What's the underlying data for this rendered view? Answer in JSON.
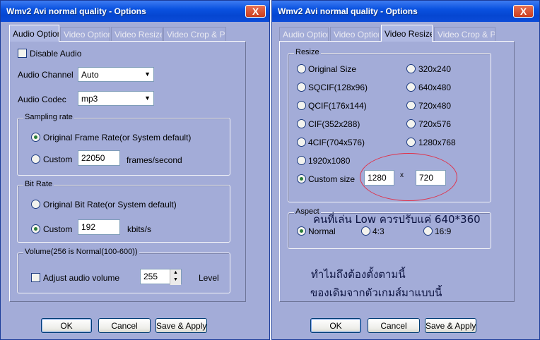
{
  "left_window": {
    "title": "Wmv2 Avi normal quality - Options",
    "close_label": "X",
    "tabs": [
      "Audio Option",
      "Video Option",
      "Video Resize",
      "Video Crop & Pac"
    ],
    "disable_audio_label": "Disable Audio",
    "audio_channel_label": "Audio Channel",
    "audio_channel_value": "Auto",
    "audio_codec_label": "Audio Codec",
    "audio_codec_value": "mp3",
    "sampling": {
      "legend": "Sampling rate",
      "original_label": "Original Frame Rate(or System default)",
      "custom_label": "Custom",
      "custom_value": "22050",
      "unit": "frames/second"
    },
    "bitrate": {
      "legend": "Bit Rate",
      "original_label": "Original Bit Rate(or System default)",
      "custom_label": "Custom",
      "custom_value": "192",
      "unit": "kbits/s"
    },
    "volume": {
      "legend": "Volume(256 is Normal(100-600))",
      "adjust_label": "Adjust audio volume",
      "value": "255",
      "level_label": "Level"
    },
    "buttons": {
      "ok": "OK",
      "cancel": "Cancel",
      "save": "Save & Apply"
    }
  },
  "right_window": {
    "title": "Wmv2 Avi normal quality - Options",
    "close_label": "X",
    "tabs": [
      "Audio Option",
      "Video Option",
      "Video Resize",
      "Video Crop & Pac"
    ],
    "resize": {
      "legend": "Resize",
      "left_options": [
        "Original Size",
        "SQCIF(128x96)",
        "QCIF(176x144)",
        "CIF(352x288)",
        "4CIF(704x576)",
        "1920x1080",
        "Custom size"
      ],
      "right_options": [
        "320x240",
        "640x480",
        "720x480",
        "720x576",
        "1280x768"
      ],
      "custom_width": "1280",
      "times": "x",
      "custom_height": "720"
    },
    "aspect": {
      "legend": "Aspect",
      "options": [
        "Normal",
        "4:3",
        "16:9"
      ]
    },
    "annotations": {
      "line1": "คนที่เล่น Low  ควรปรับแค่ 640*360",
      "line2": "ทำไมถึงต้องตั้งตามนี้",
      "line3": "ของเดิมจากตัวเกมส์มาแบบนี้"
    },
    "buttons": {
      "ok": "OK",
      "cancel": "Cancel",
      "save": "Save & Apply"
    }
  }
}
